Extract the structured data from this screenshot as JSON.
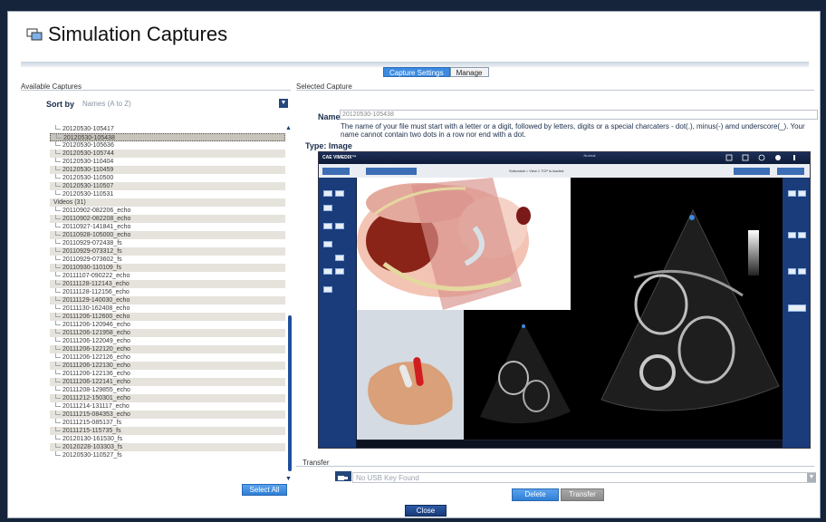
{
  "window": {
    "title": "Simulation Captures"
  },
  "tabs": [
    {
      "label": "Capture Settings",
      "active": true
    },
    {
      "label": "Manage",
      "active": false
    }
  ],
  "left_panel": {
    "heading": "Available Captures",
    "sort_label": "Sort by",
    "sort_value": "Names (A to Z)",
    "items": [
      {
        "label": "20120530-105417",
        "type": "item"
      },
      {
        "label": "20120530-105438",
        "type": "item",
        "selected": true
      },
      {
        "label": "20120530-105636",
        "type": "item"
      },
      {
        "label": "20120530-105744",
        "type": "item"
      },
      {
        "label": "20120530-110404",
        "type": "item"
      },
      {
        "label": "20120530-110459",
        "type": "item"
      },
      {
        "label": "20120530-110500",
        "type": "item"
      },
      {
        "label": "20120530-110507",
        "type": "item"
      },
      {
        "label": "20120530-110531",
        "type": "item"
      },
      {
        "label": "Videos (31)",
        "type": "folder"
      },
      {
        "label": "20110902-082206_echo",
        "type": "item"
      },
      {
        "label": "20110902-082208_echo",
        "type": "item"
      },
      {
        "label": "20110927-141841_echo",
        "type": "item"
      },
      {
        "label": "20110928-105000_echo",
        "type": "item"
      },
      {
        "label": "20110929-072438_fs",
        "type": "item"
      },
      {
        "label": "20110929-073312_fs",
        "type": "item"
      },
      {
        "label": "20110929-073602_fs",
        "type": "item"
      },
      {
        "label": "20110930-110109_fs",
        "type": "item"
      },
      {
        "label": "20111107-090222_echo",
        "type": "item"
      },
      {
        "label": "20111128-112143_echo",
        "type": "item"
      },
      {
        "label": "20111128-112156_echo",
        "type": "item"
      },
      {
        "label": "20111129-140030_echo",
        "type": "item"
      },
      {
        "label": "20111130-162408_echo",
        "type": "item"
      },
      {
        "label": "20111206-112600_echo",
        "type": "item"
      },
      {
        "label": "20111206-120946_echo",
        "type": "item"
      },
      {
        "label": "20111206-121958_echo",
        "type": "item"
      },
      {
        "label": "20111206-122049_echo",
        "type": "item"
      },
      {
        "label": "20111206-122120_echo",
        "type": "item"
      },
      {
        "label": "20111206-122126_echo",
        "type": "item"
      },
      {
        "label": "20111206-122130_echo",
        "type": "item"
      },
      {
        "label": "20111206-122136_echo",
        "type": "item"
      },
      {
        "label": "20111206-122141_echo",
        "type": "item"
      },
      {
        "label": "20111208-129855_echo",
        "type": "item"
      },
      {
        "label": "20111212-150301_echo",
        "type": "item"
      },
      {
        "label": "20111214-131117_echo",
        "type": "item"
      },
      {
        "label": "20111215-084353_echo",
        "type": "item"
      },
      {
        "label": "20111215-085137_fs",
        "type": "item"
      },
      {
        "label": "20111215-115735_fs",
        "type": "item"
      },
      {
        "label": "20120130-161530_fs",
        "type": "item"
      },
      {
        "label": "20120228-103303_fs",
        "type": "item"
      },
      {
        "label": "20120530-110527_fs",
        "type": "item"
      }
    ],
    "select_all_label": "Select All"
  },
  "right_panel": {
    "heading": "Selected Capture",
    "name_label": "Name",
    "name_value": "20120530-105438",
    "help_text": "The name of your file must start with a letter or a digit, followed by letters, digits or a special charcaters - dot(.), minus(-) amd underscore(_). Your name cannot contain two dots in a row nor end with a dot.",
    "type_label": "Type: Image",
    "capture": {
      "brand": "CAE VIMEDIX™",
      "header_center": "Normal",
      "toolbar_note": "Subcostal = View 1 TCP is loaded."
    },
    "transfer_heading": "Transfer",
    "usb_placeholder": "No USB Key Found",
    "delete_label": "Delete",
    "transfer_label": "Transfer"
  },
  "footer": {
    "close_label": "Close"
  },
  "colors": {
    "accent_blue": "#3c8be0",
    "navy": "#1b3c7a",
    "selection": "#c8c3bb",
    "alt_row": "#e6e3dd"
  }
}
